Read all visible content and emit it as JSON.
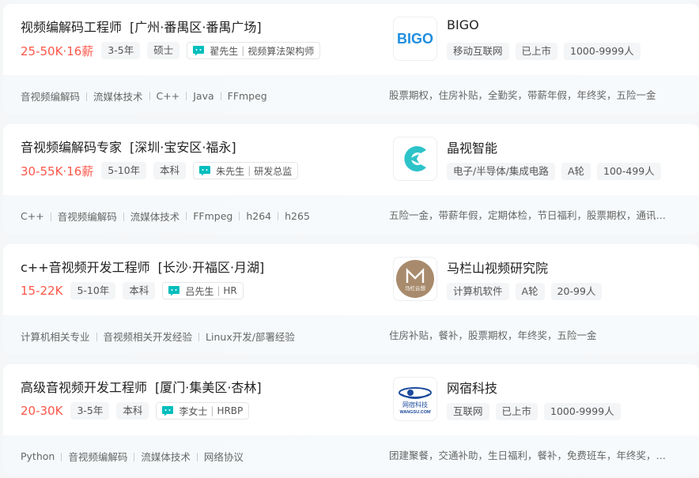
{
  "jobs": [
    {
      "title": "视频编解码工程师",
      "area": "[广州·番禺区·番禺广场]",
      "salary": "25-50K·16薪",
      "tags": [
        "3-5年",
        "硕士"
      ],
      "recruiter": {
        "name": "翟先生",
        "role": "视频算法架构师"
      },
      "company": {
        "name": "BIGO",
        "logo_text": "BIGO",
        "tags": [
          "移动互联网",
          "已上市",
          "1000-9999人"
        ]
      },
      "skills": [
        "音视频编解码",
        "流媒体技术",
        "C++",
        "Java",
        "FFmpeg"
      ],
      "welfare": "股票期权，住房补贴，全勤奖，带薪年假，年终奖，五险一金"
    },
    {
      "title": "音视频编解码专家",
      "area": "[深圳·宝安区·福永]",
      "salary": "30-55K·16薪",
      "tags": [
        "5-10年",
        "本科"
      ],
      "recruiter": {
        "name": "朱先生",
        "role": "研发总监"
      },
      "company": {
        "name": "晶视智能",
        "logo_text": "",
        "tags": [
          "电子/半导体/集成电路",
          "A轮",
          "100-499人"
        ]
      },
      "skills": [
        "C++",
        "音视频编解码",
        "流媒体技术",
        "FFmpeg",
        "h264",
        "h265"
      ],
      "welfare": "五险一金，带薪年假，定期体检，节日福利，股票期权，通讯补贴"
    },
    {
      "title": "c++音视频开发工程师",
      "area": "[长沙·开福区·月湖]",
      "salary": "15-22K",
      "tags": [
        "5-10年",
        "本科"
      ],
      "recruiter": {
        "name": "吕先生",
        "role": "HR"
      },
      "company": {
        "name": "马栏山视频研究院",
        "logo_text": "马栏云想",
        "tags": [
          "计算机软件",
          "A轮",
          "20-99人"
        ]
      },
      "skills": [
        "计算机相关专业",
        "音视频相关开发经验",
        "Linux开发/部署经验"
      ],
      "welfare": "住房补贴，餐补，股票期权，年终奖，五险一金"
    },
    {
      "title": "高级音视频开发工程师",
      "area": "[厦门·集美区·杏林]",
      "salary": "20-30K",
      "tags": [
        "3-5年",
        "本科"
      ],
      "recruiter": {
        "name": "李女士",
        "role": "HRBP"
      },
      "company": {
        "name": "网宿科技",
        "logo_text": "网宿科技",
        "logo_sub": "WANGSU.COM",
        "tags": [
          "互联网",
          "已上市",
          "1000-9999人"
        ]
      },
      "skills": [
        "Python",
        "音视频编解码",
        "流媒体技术",
        "网络协议"
      ],
      "welfare": "团建聚餐，交通补助，生日福利，餐补，免费班车，年终奖，五险一金"
    }
  ],
  "colors": {
    "salary": "#fe574a",
    "accent": "#00bebd"
  },
  "icons": [
    "chat-icon"
  ]
}
